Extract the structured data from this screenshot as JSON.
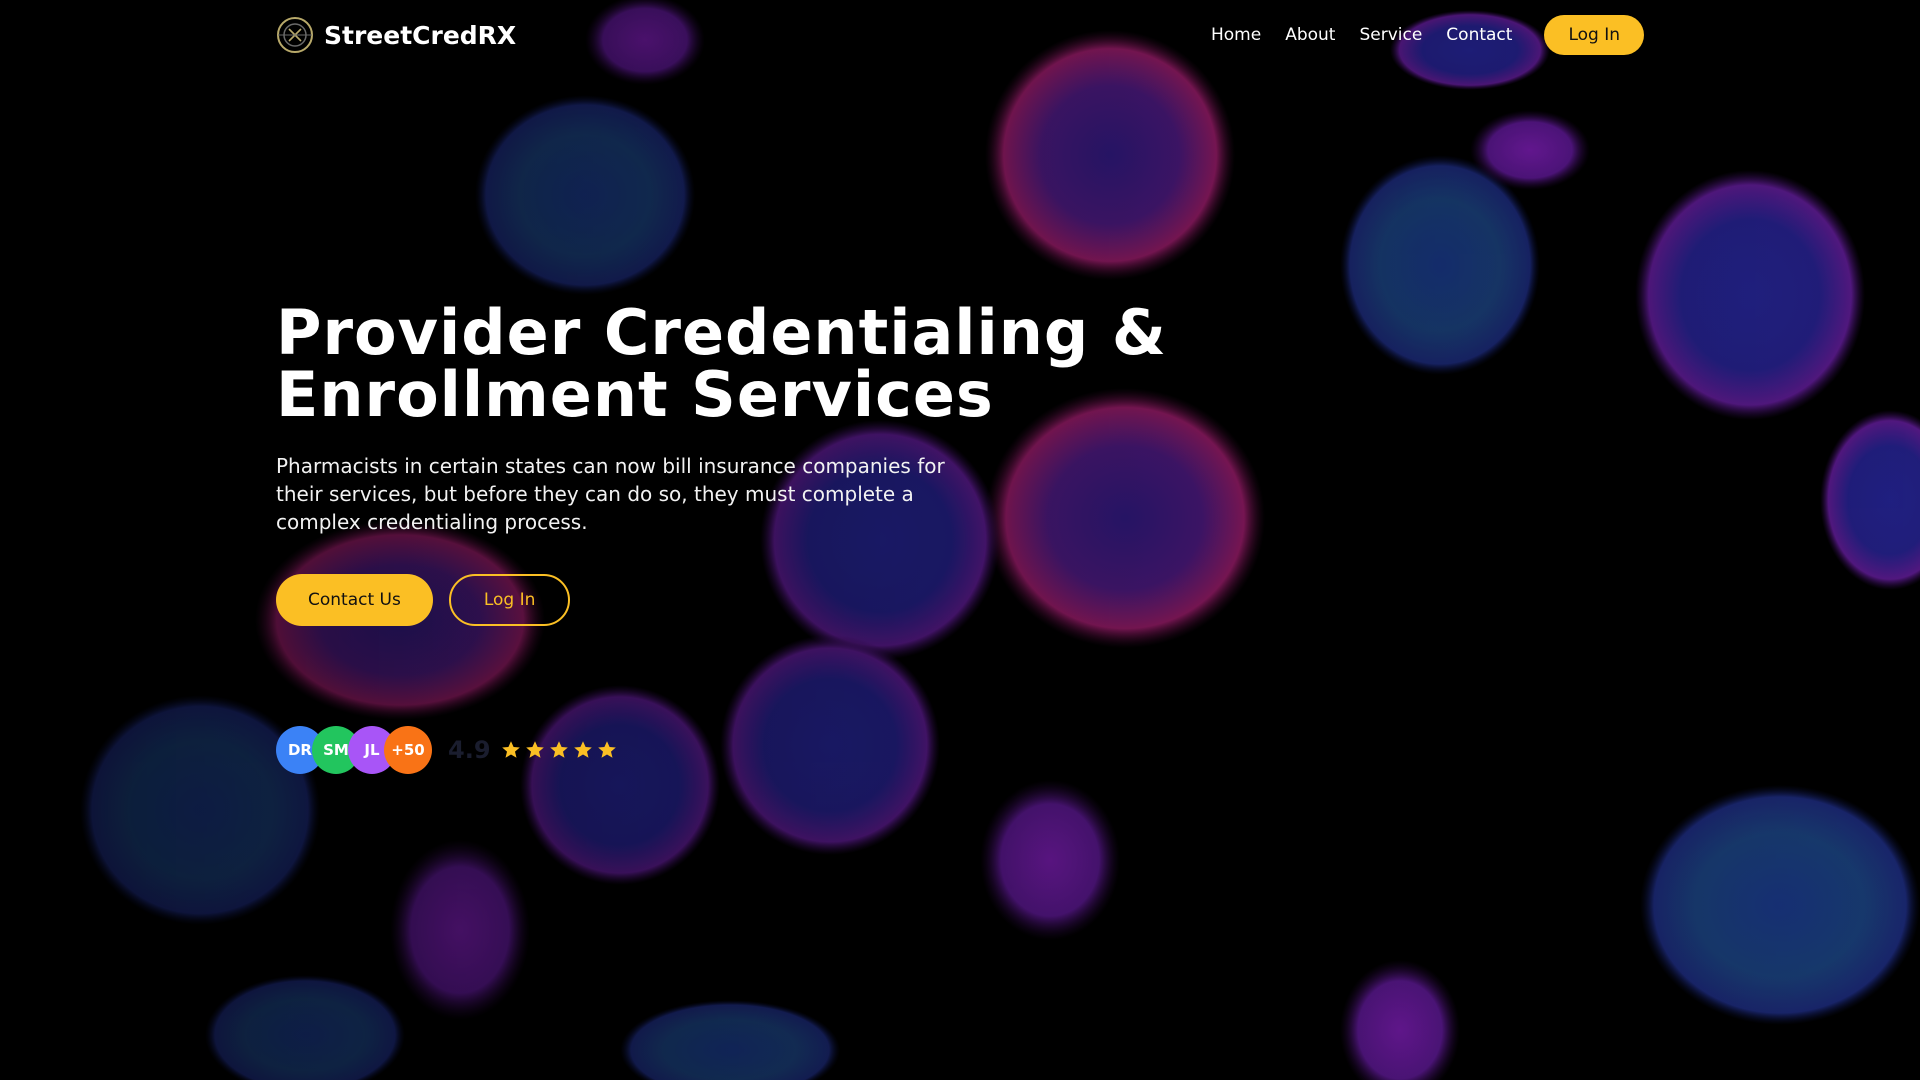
{
  "brand": {
    "name": "StreetCredRX",
    "logo_icon": "globe-pill-logo-icon"
  },
  "nav": {
    "links": [
      {
        "label": "Home"
      },
      {
        "label": "About"
      },
      {
        "label": "Service"
      },
      {
        "label": "Contact"
      }
    ],
    "login_label": "Log In"
  },
  "hero": {
    "title_line1": "Provider Credentialing &",
    "title_line2": "Enrollment Services",
    "subtitle": "Pharmacists in certain states can now bill insurance companies for their services, but before they can do so, they must complete a complex credentialing process.",
    "contact_label": "Contact Us",
    "login_label": "Log In"
  },
  "social_proof": {
    "avatars": [
      {
        "initials": "DR",
        "color": "#3b82f6"
      },
      {
        "initials": "SM",
        "color": "#22c55e"
      },
      {
        "initials": "JL",
        "color": "#a855f7"
      },
      {
        "initials": "+50",
        "color": "#f97316"
      }
    ],
    "rating": "4.9",
    "stars": 5,
    "star_color": "#fbbf24"
  },
  "colors": {
    "accent": "#fbbf24",
    "background": "#000000"
  }
}
